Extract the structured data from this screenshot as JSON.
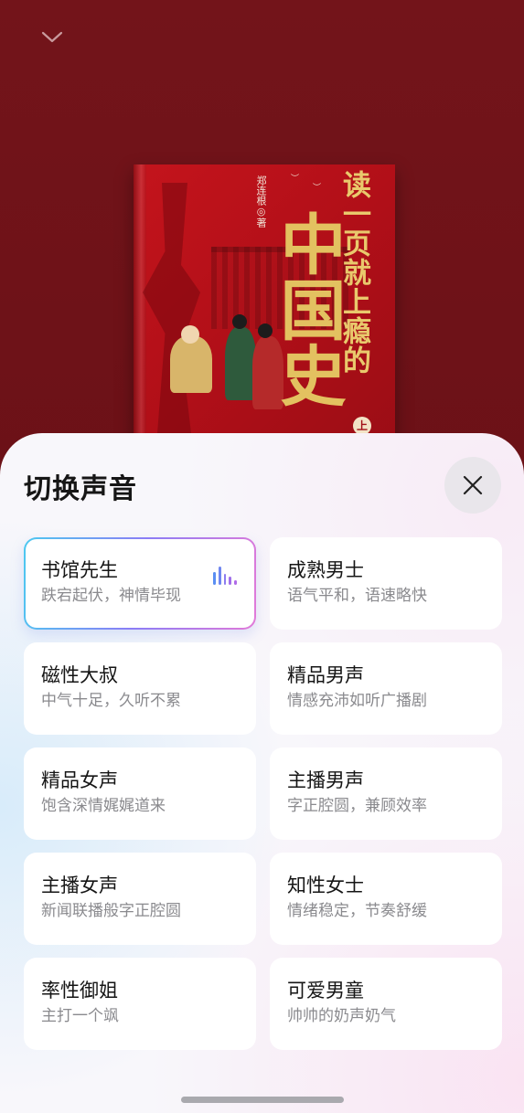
{
  "book": {
    "author": "郑连根◎著",
    "title_small": "读一页就上瘾的",
    "title_big": "中国史",
    "volume": "上"
  },
  "sheet": {
    "title": "切换声音"
  },
  "voices": [
    {
      "name": "书馆先生",
      "desc": "跌宕起伏，神情毕现",
      "selected": true
    },
    {
      "name": "成熟男士",
      "desc": "语气平和，语速略快",
      "selected": false
    },
    {
      "name": "磁性大叔",
      "desc": "中气十足，久听不累",
      "selected": false
    },
    {
      "name": "精品男声",
      "desc": "情感充沛如听广播剧",
      "selected": false
    },
    {
      "name": "精品女声",
      "desc": "饱含深情娓娓道来",
      "selected": false
    },
    {
      "name": "主播男声",
      "desc": "字正腔圆，兼顾效率",
      "selected": false
    },
    {
      "name": "主播女声",
      "desc": "新闻联播般字正腔圆",
      "selected": false
    },
    {
      "name": "知性女士",
      "desc": "情绪稳定，节奏舒缓",
      "selected": false
    },
    {
      "name": "率性御姐",
      "desc": "主打一个飒",
      "selected": false
    },
    {
      "name": "可爱男童",
      "desc": "帅帅的奶声奶气",
      "selected": false
    }
  ],
  "icons": {
    "collapse": "chevron-down-icon",
    "close": "close-icon",
    "playing": "audio-wave-icon"
  },
  "colors": {
    "background": "#6e1218",
    "selected_border_start": "#4cc9f0",
    "selected_border_end": "#e27ad8",
    "wave_blue": "#5a8ef2",
    "wave_purple": "#b06ae8"
  }
}
